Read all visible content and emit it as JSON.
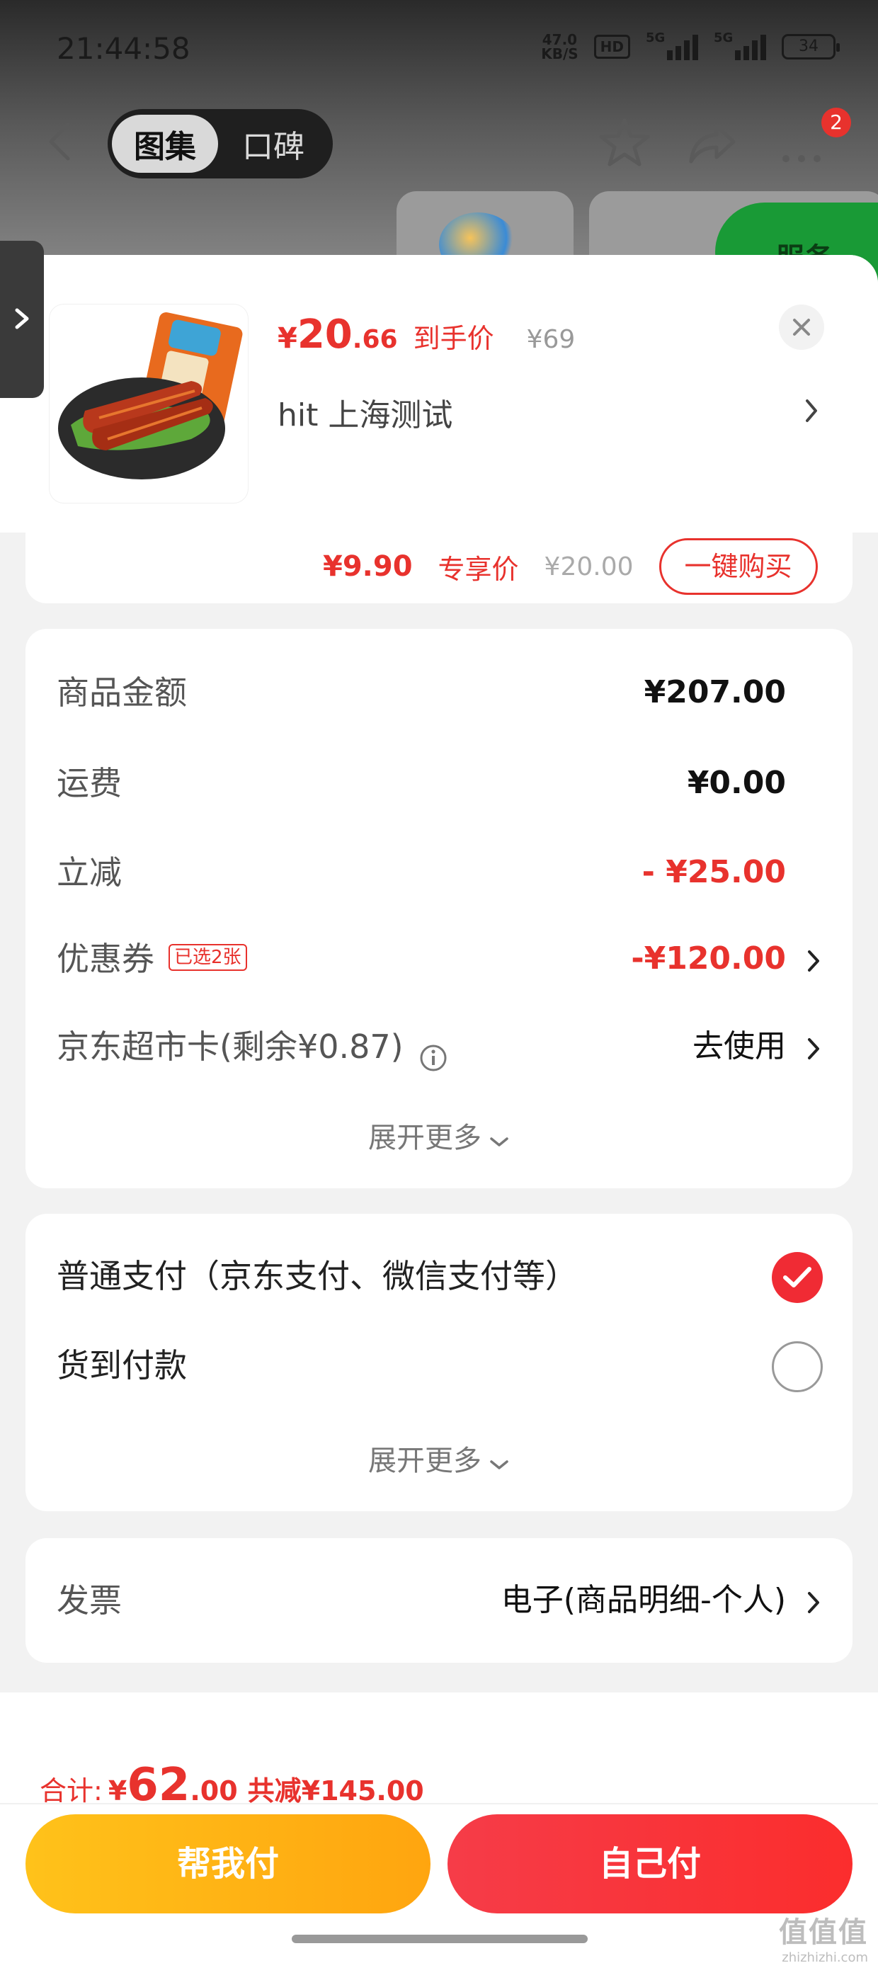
{
  "status_bar": {
    "time": "21:44:58",
    "net_speed_value": "47.0",
    "net_speed_unit": "KB/S",
    "hd_label": "HD",
    "signal1_label": "5G",
    "signal2_label": "5G",
    "battery": "34"
  },
  "nav": {
    "tab_gallery": "图集",
    "tab_reviews": "口碑",
    "more_badge": "2",
    "banner_partial": "服务"
  },
  "product": {
    "price_yen": "¥",
    "price_int": "20",
    "price_dec": ".66",
    "price_tag": "到手价",
    "orig_price": "¥69",
    "name": "hit  上海测试"
  },
  "peek": {
    "price": "¥9.90",
    "tag": "专享价",
    "orig": "¥20.00",
    "button": "一键购买"
  },
  "summary": {
    "rows": [
      {
        "label": "商品金额",
        "value": "¥207.00"
      },
      {
        "label": "运费",
        "value": "¥0.00"
      },
      {
        "label": "立减",
        "value": "- ¥25.00"
      },
      {
        "label": "优惠券",
        "chip": "已选2张",
        "value": "-¥120.00"
      },
      {
        "label": "京东超市卡(剩余¥0.87)",
        "value": "去使用"
      }
    ],
    "expand": "展开更多"
  },
  "payment": {
    "options": [
      {
        "label": "普通支付（京东支付、微信支付等）",
        "selected": true
      },
      {
        "label": "货到付款",
        "selected": false
      }
    ],
    "expand": "展开更多"
  },
  "invoice": {
    "label": "发票",
    "value": "电子(商品明细-个人)"
  },
  "bottom": {
    "total_label": "合计:",
    "total_yen": "¥",
    "total_int": "62",
    "total_dec": ".00",
    "total_saved": "共减¥145.00",
    "btn_help": "帮我付",
    "btn_self": "自己付"
  },
  "watermark": {
    "big": "值值值",
    "small": "zhizhizhi.com"
  },
  "colors": {
    "accent_red": "#e8322d",
    "help_yellow": "#ffb515",
    "self_red": "#f63c48"
  }
}
